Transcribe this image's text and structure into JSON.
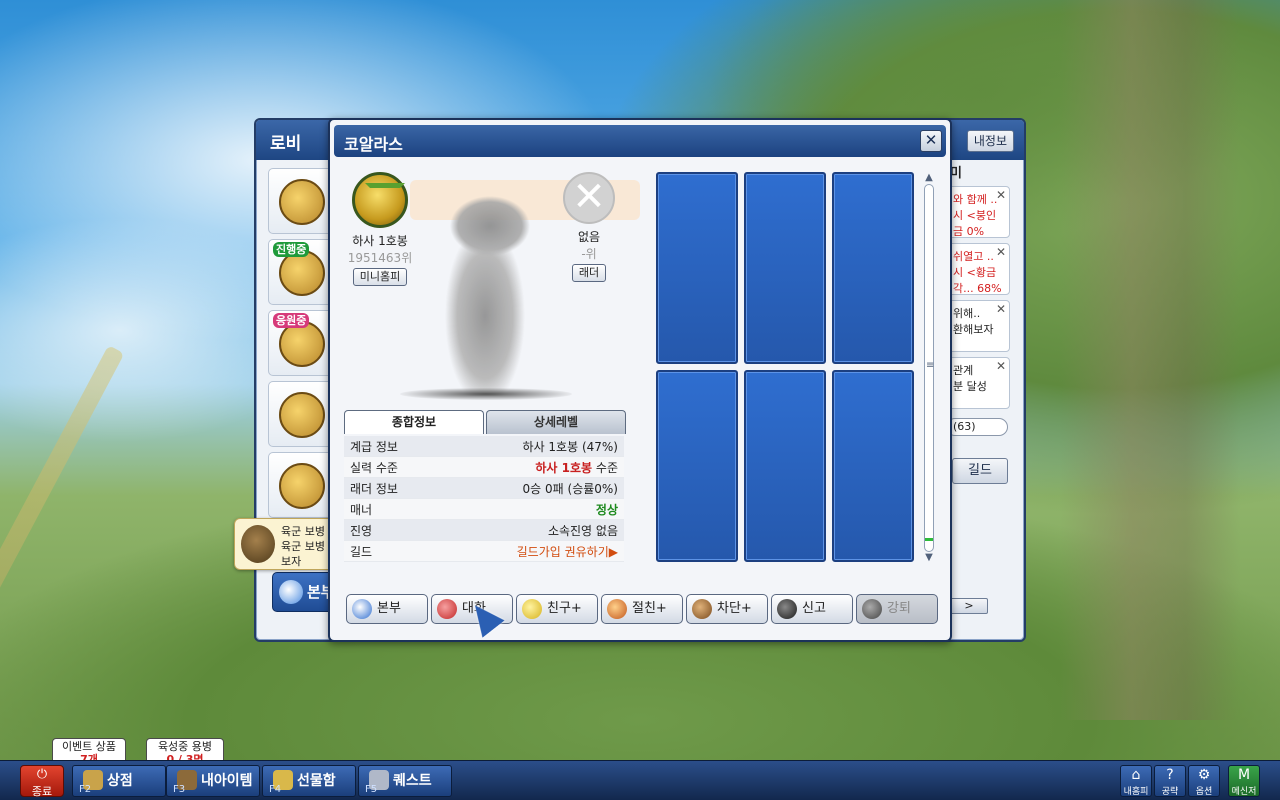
{
  "lobby": {
    "title": "로비",
    "my_info_button": "내정보",
    "list_badges": [
      "진행중",
      "응원중"
    ],
    "bottom_button": "본부",
    "tooltip": {
      "line1": "육군 보병",
      "line2": "육군 보병",
      "line3": "보자"
    }
  },
  "right_panel": {
    "header": "미",
    "cards": [
      {
        "line1": "와 함께 ..",
        "line2": "시 <붕인",
        "line3": "금 0%"
      },
      {
        "line1": "쉬열고 ..",
        "line2": "시 <황금",
        "line3": "각... 68%"
      },
      {
        "line1": "위해..",
        "line2": "환해보자",
        "line3": ""
      },
      {
        "line1": "관계",
        "line2": "분 달성",
        "line3": ""
      }
    ],
    "count": "(63)",
    "guild_button": "길드",
    "next_button": ">"
  },
  "dialog": {
    "title": "코알라스",
    "close_label": "✕",
    "rank": {
      "name": "하사 1호봉",
      "number": "1951463위",
      "button": "미니홈피"
    },
    "ladder": {
      "label": "없음",
      "rank": "-위",
      "button": "래더",
      "icon": "✕"
    },
    "tabs": {
      "summary": "종합정보",
      "detail": "상세레벨"
    },
    "info_rows": [
      {
        "label": "계급 정보",
        "value": "하사 1호봉 (47%)"
      },
      {
        "label": "실력 수준",
        "value_red": "하사 1호봉",
        "value_suffix": " 수준"
      },
      {
        "label": "래더 정보",
        "value": "0승 0패 (승률0%)"
      },
      {
        "label": "매너",
        "value": "정상"
      },
      {
        "label": "진영",
        "value": "소속진영 없음"
      },
      {
        "label": "길드",
        "value": "길드가입 권유하기▶"
      }
    ],
    "actions": [
      {
        "label": "본부",
        "icon": "hq-icon"
      },
      {
        "label": "대화",
        "icon": "chat-icon"
      },
      {
        "label": "친구+",
        "icon": "friend-add-icon"
      },
      {
        "label": "절친+",
        "icon": "best-friend-add-icon"
      },
      {
        "label": "차단+",
        "icon": "block-icon"
      },
      {
        "label": "신고",
        "icon": "report-icon"
      },
      {
        "label": "강퇴",
        "icon": "kick-icon"
      }
    ]
  },
  "taskbar": {
    "exit": {
      "icon": "⏻",
      "label": "종료"
    },
    "buttons": [
      {
        "fkey": "F2",
        "label": "상점"
      },
      {
        "fkey": "F3",
        "label": "내아이템"
      },
      {
        "fkey": "F4",
        "label": "선물함"
      },
      {
        "fkey": "F5",
        "label": "퀘스트"
      }
    ],
    "event": {
      "label": "이벤트 상품",
      "value": "7개"
    },
    "training": {
      "label": "육성중 용병",
      "value": "0 / 3명"
    },
    "right": [
      {
        "icon": "⌂",
        "label": "내홈피"
      },
      {
        "icon": "?",
        "label": "공략"
      },
      {
        "icon": "⚙",
        "label": "옵션"
      },
      {
        "icon": "M",
        "label": "메신저"
      }
    ]
  },
  "colors": {
    "title_bar": "#1c4280",
    "card_blue": "#2f6ed0",
    "value_red": "#c82020",
    "value_green": "#1e8a1e",
    "value_orange": "#d24d10"
  }
}
